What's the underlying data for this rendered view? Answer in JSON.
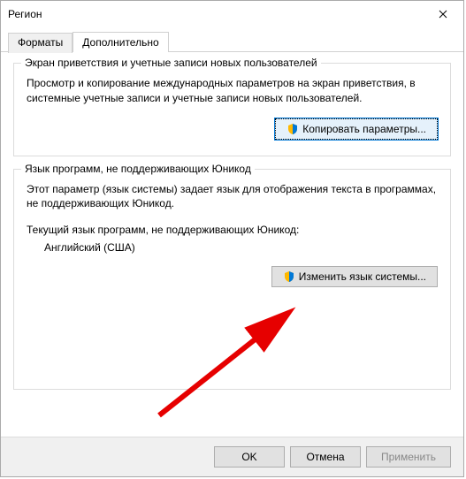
{
  "window": {
    "title": "Регион"
  },
  "tabs": {
    "formats": "Форматы",
    "advanced": "Дополнительно"
  },
  "group1": {
    "legend": "Экран приветствия и учетные записи новых пользователей",
    "description": "Просмотр и копирование международных параметров на экран приветствия, в системные учетные записи и учетные записи новых пользователей.",
    "button": "Копировать параметры..."
  },
  "group2": {
    "legend": "Язык программ, не поддерживающих Юникод",
    "description": "Этот параметр (язык системы) задает язык для отображения текста в программах, не поддерживающих Юникод.",
    "current_label": "Текущий язык программ, не поддерживающих Юникод:",
    "current_value": "Английский (США)",
    "button": "Изменить язык системы..."
  },
  "footer": {
    "ok": "OK",
    "cancel": "Отмена",
    "apply": "Применить"
  }
}
